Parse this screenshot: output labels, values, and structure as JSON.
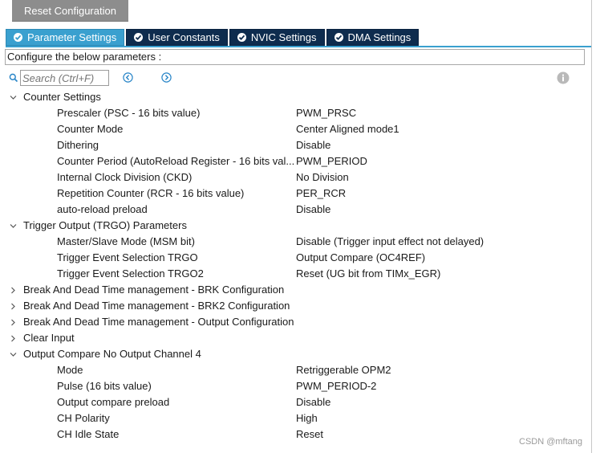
{
  "toolbar": {
    "reset_label": "Reset Configuration"
  },
  "tabs": [
    {
      "label": "Parameter Settings",
      "active": true,
      "icon": "check-circle-icon"
    },
    {
      "label": "User Constants",
      "active": false,
      "icon": "check-circle-icon"
    },
    {
      "label": "NVIC Settings",
      "active": false,
      "icon": "check-circle-icon"
    },
    {
      "label": "DMA Settings",
      "active": false,
      "icon": "check-circle-icon"
    }
  ],
  "config_text": "Configure the below parameters :",
  "search": {
    "placeholder": "Search (Ctrl+F)"
  },
  "colors": {
    "active_tab": "#3aa0cf",
    "inactive_tab": "#0e2c4e",
    "reset_button": "#8d8d8d"
  },
  "groups": [
    {
      "label": "Counter Settings",
      "expanded": true,
      "params": [
        {
          "name": "Prescaler (PSC - 16 bits value)",
          "value": "PWM_PRSC"
        },
        {
          "name": "Counter Mode",
          "value": "Center Aligned mode1"
        },
        {
          "name": "Dithering",
          "value": "Disable"
        },
        {
          "name": "Counter Period (AutoReload Register - 16 bits val...",
          "value": "PWM_PERIOD"
        },
        {
          "name": "Internal Clock Division (CKD)",
          "value": "No Division"
        },
        {
          "name": "Repetition Counter (RCR - 16 bits value)",
          "value": "PER_RCR"
        },
        {
          "name": "auto-reload preload",
          "value": "Disable"
        }
      ]
    },
    {
      "label": "Trigger Output (TRGO) Parameters",
      "expanded": true,
      "params": [
        {
          "name": "Master/Slave Mode (MSM bit)",
          "value": "Disable (Trigger input effect not delayed)"
        },
        {
          "name": "Trigger Event Selection TRGO",
          "value": "Output Compare (OC4REF)"
        },
        {
          "name": "Trigger Event Selection TRGO2",
          "value": "Reset (UG bit from TIMx_EGR)"
        }
      ]
    },
    {
      "label": "Break And Dead Time management - BRK Configuration",
      "expanded": false,
      "params": []
    },
    {
      "label": "Break And Dead Time management - BRK2 Configuration",
      "expanded": false,
      "params": []
    },
    {
      "label": "Break And Dead Time management - Output Configuration",
      "expanded": false,
      "params": []
    },
    {
      "label": "Clear Input",
      "expanded": false,
      "params": []
    },
    {
      "label": "Output Compare No Output Channel 4",
      "expanded": true,
      "params": [
        {
          "name": "Mode",
          "value": "Retriggerable OPM2"
        },
        {
          "name": "Pulse (16 bits value)",
          "value": "PWM_PERIOD-2"
        },
        {
          "name": "Output compare preload",
          "value": "Disable"
        },
        {
          "name": "CH Polarity",
          "value": "High"
        },
        {
          "name": "CH Idle State",
          "value": "Reset"
        }
      ]
    }
  ],
  "watermark": "CSDN @mftang"
}
